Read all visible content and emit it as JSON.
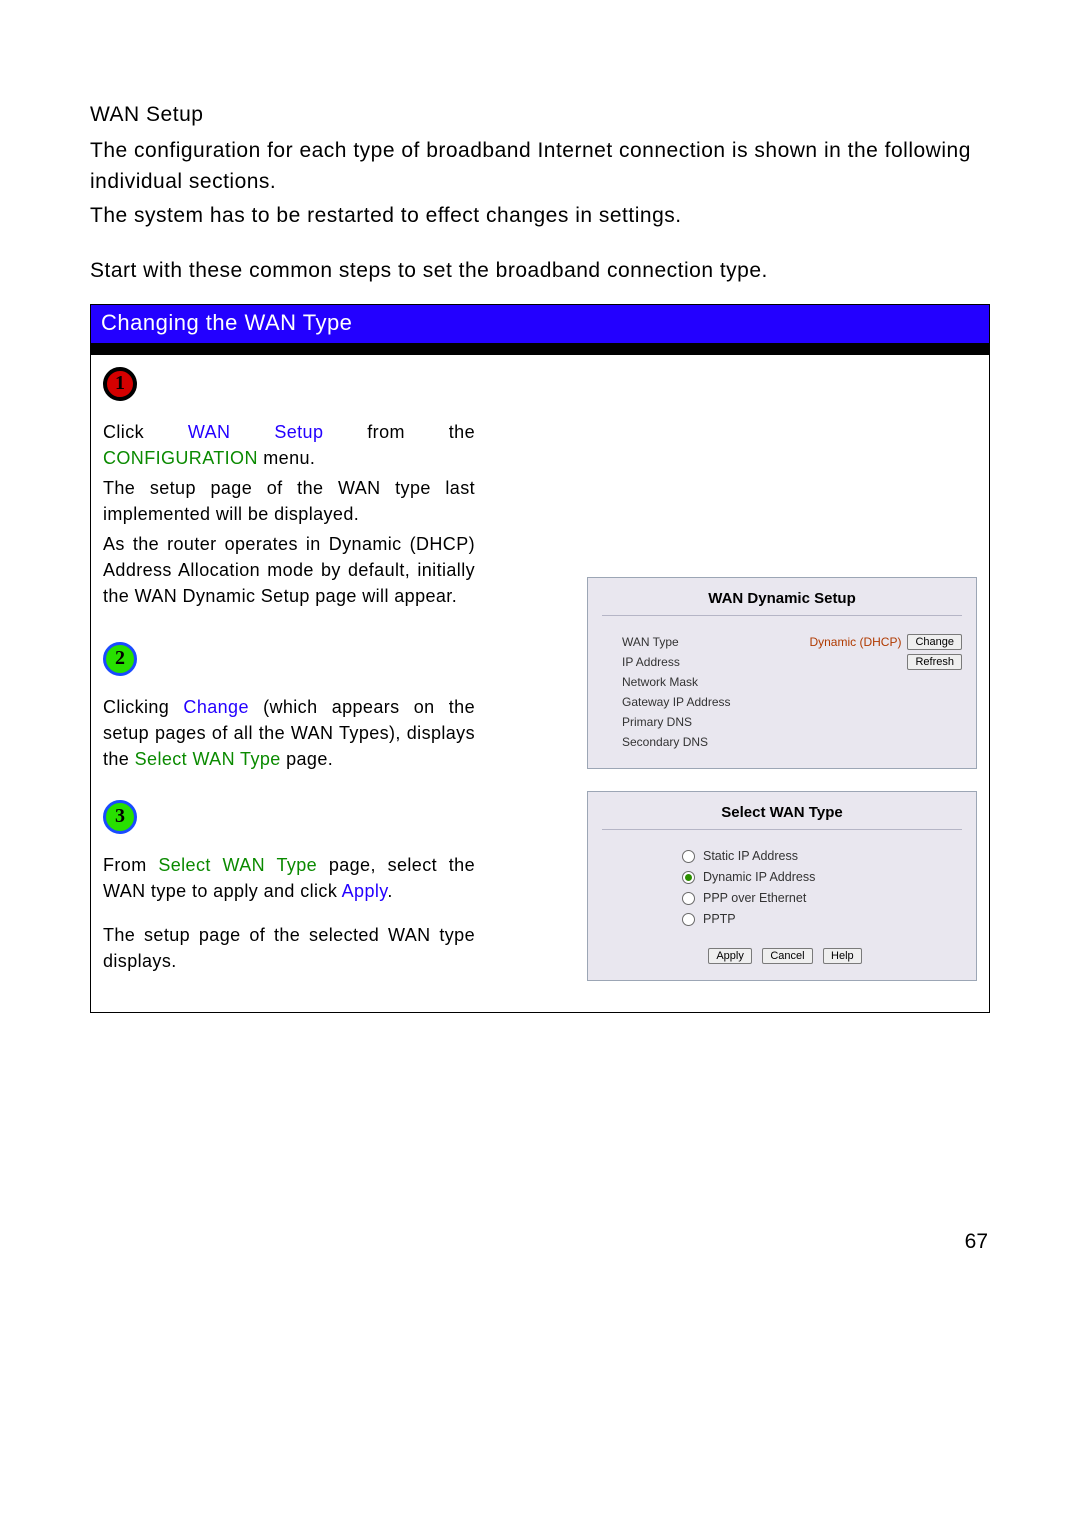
{
  "page_number": "67",
  "intro": {
    "title": "WAN Setup",
    "p1": "The configuration for each type of broadband Internet connection is shown in the following individual sections.",
    "p2": "The system has to be restarted to effect changes in settings.",
    "p3": "Start with these common steps to set the broadband connection type."
  },
  "panel": {
    "header": "Changing the WAN Type"
  },
  "steps": {
    "s1": {
      "num": "1",
      "l1a": "Click ",
      "l1b": "WAN Setup",
      "l1c": " from the ",
      "l1d": "CONFIGURATION",
      "l1e": " menu.",
      "l2": "The setup page of the WAN type last implemented will be displayed.",
      "l3": "As the router operates in Dynamic (DHCP) Address Allocation mode by default, initially the WAN Dynamic Setup page will appear."
    },
    "s2": {
      "num": "2",
      "l1a": "Clicking ",
      "l1b": "Change",
      "l1c": " (which appears on the setup pages of all the WAN Types), displays the ",
      "l1d": "Select WAN Type",
      "l1e": " page."
    },
    "s3": {
      "num": "3",
      "l1a": "From ",
      "l1b": "Select WAN Type",
      "l1c": " page, select the WAN type to apply and click ",
      "l1d": "Apply",
      "l1e": ".",
      "l2": "The setup page of the selected WAN type displays."
    }
  },
  "router1": {
    "title": "WAN Dynamic Setup",
    "rows": {
      "wan_type_label": "WAN Type",
      "wan_type_value": "Dynamic (DHCP)",
      "change_btn": "Change",
      "ip_label": "IP Address",
      "refresh_btn": "Refresh",
      "mask_label": "Network Mask",
      "gw_label": "Gateway IP Address",
      "pdns_label": "Primary DNS",
      "sdns_label": "Secondary DNS"
    }
  },
  "router2": {
    "title": "Select WAN Type",
    "options": {
      "o1": "Static IP Address",
      "o2": "Dynamic IP Address",
      "o3": "PPP over Ethernet",
      "o4": "PPTP"
    },
    "selected_index": 1,
    "buttons": {
      "apply": "Apply",
      "cancel": "Cancel",
      "help": "Help"
    }
  }
}
